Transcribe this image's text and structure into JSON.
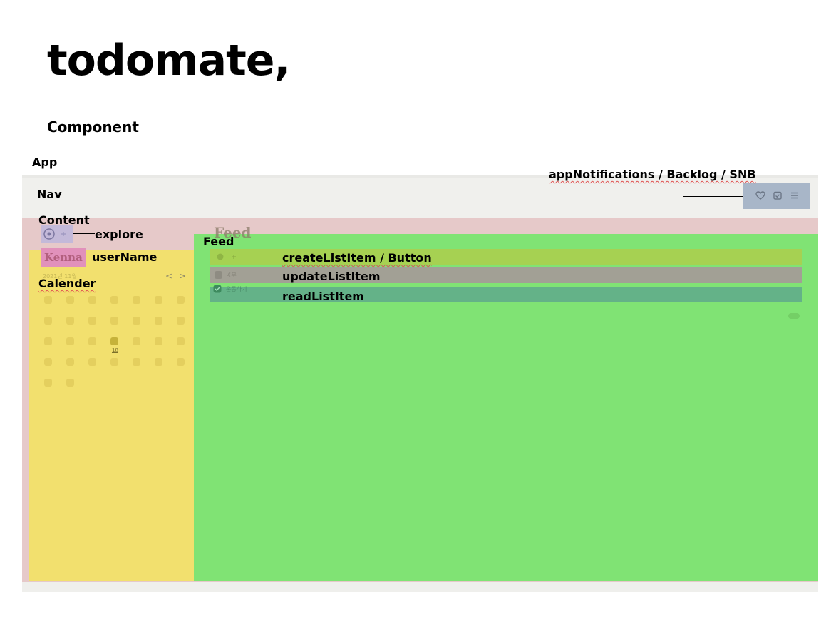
{
  "title": "todomate,",
  "subtitle": "Component",
  "labels": {
    "app": "App",
    "nav": "Nav",
    "content": "Content",
    "explore": "explore",
    "user_name": "userName",
    "calender": "Calender",
    "feed": "Feed",
    "app_notifications": "appNotifications / Backlog / SNB",
    "create_list_item": "createListItem / Button",
    "update_list_item": "updateListItem",
    "read_list_item": "readListItem"
  },
  "mockup": {
    "user_name": "Kenna",
    "feed_heading": "Feed",
    "calendar_header": "2021년 11월",
    "calendar_prev": "<",
    "calendar_next": ">",
    "calendar_today": "18",
    "update_item_text": "공부",
    "read_item_text": "운동하기",
    "nav_icons": [
      "heart-icon",
      "calendar-check-icon",
      "menu-icon"
    ]
  },
  "colors": {
    "nav": "#f0f0ed",
    "content": "#e6c9c9",
    "calender": "#f2e06e",
    "feed": "#80e374",
    "explore": "#c3b9d9",
    "user_name": "#e191bb",
    "app_notifications": "#a8b6c8",
    "create_list_item": "#a6d152",
    "update_list_item": "#a2a095",
    "read_list_item": "#64b288"
  }
}
